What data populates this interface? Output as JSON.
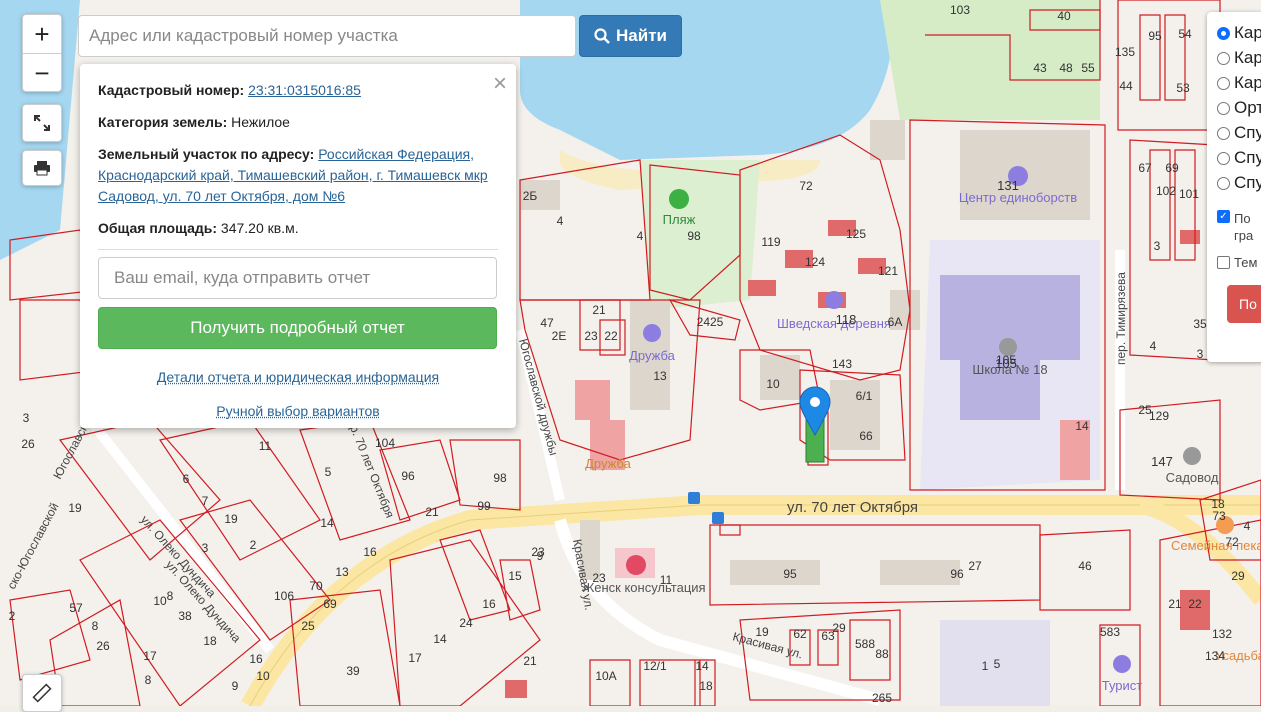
{
  "search": {
    "placeholder": "Адрес или кадастровый номер участка",
    "button_label": "Найти"
  },
  "controls": {
    "zoom_in": "+",
    "zoom_out": "−"
  },
  "popup": {
    "cad_label": "Кадастровый номер:",
    "cad_value": "23:31:0315016:85",
    "cat_label": "Категория земель:",
    "cat_value": "Нежилое",
    "addr_label": "Земельный участок по адресу:",
    "addr_value": "Российская Федерация, Краснодарский край, Тимашевский район, г. Тимашевск мкр Садовод, ул. 70 лет Октября, дом №6",
    "area_label": "Общая площадь:",
    "area_value": "347.20 кв.м.",
    "email_placeholder": "Ваш email, куда отправить отчет",
    "report_button": "Получить подробный отчет",
    "details_link": "Детали отчета и юридическая информация",
    "manual_link": "Ручной выбор вариантов",
    "close": "×"
  },
  "layers": {
    "radios": [
      "Кар",
      "Кар",
      "Кар",
      "Орт",
      "Спу",
      "Спу",
      "Спу"
    ],
    "selected_index": 0,
    "checkboxes": [
      {
        "label": "По",
        "label2": "гра",
        "checked": true
      },
      {
        "label": "Тем",
        "checked": false
      }
    ],
    "button": "По"
  },
  "map_labels": {
    "street_main": "ул. 70 лет Октября",
    "street_kras": "Красивая ул.",
    "street_kras2": "Красивая ул.",
    "street_yugo": "Югославской дружбы",
    "street_yugo2": "Югославской друж",
    "street_yugo3": "ско-Югославской",
    "street_oleko": "ул. Олеко Дундича",
    "street_oleko2": "ул. Олеко Дундича",
    "street_timir": "пер. Тимирязева",
    "street_70": "пер. 70 лет Октября",
    "poi_plyazh": "Пляж",
    "poi_druzhba": "Дружба",
    "poi_druzhba2": "Дружба",
    "poi_shved": "Шведская деревня",
    "poi_center": "Центр единоборств",
    "poi_school": "Школа № 18",
    "poi_sadovod": "Садовод",
    "poi_zhensk": "Женск консультация",
    "poi_semein": "Семейная пекарня",
    "poi_turist": "Турист",
    "poi_usadba": "Усадьба",
    "poi_131": "131",
    "poi_105": "105",
    "poi_118": "118",
    "poi_147": "147"
  },
  "parcel_numbers": [
    "103",
    "40",
    "135",
    "95",
    "54",
    "43",
    "48",
    "55",
    "44",
    "53",
    "72",
    "2Б",
    "4",
    "98",
    "4",
    "125",
    "119",
    "124",
    "121",
    "6А",
    "67",
    "69",
    "102",
    "101",
    "3",
    "47",
    "21",
    "2Е",
    "23",
    "22",
    "2425",
    "13",
    "143",
    "10",
    "6/1",
    "66",
    "105",
    "4",
    "35",
    "3",
    "25",
    "14",
    "129",
    "26",
    "104",
    "96",
    "98",
    "99",
    "21",
    "19",
    "6",
    "7",
    "19",
    "8",
    "2",
    "3",
    "11",
    "5",
    "14",
    "13",
    "16",
    "70",
    "69",
    "25",
    "106",
    "38",
    "57",
    "8",
    "26",
    "10",
    "17",
    "18",
    "16",
    "10",
    "9",
    "8",
    "23",
    "23",
    "11",
    "15",
    "16",
    "24",
    "14",
    "17",
    "21",
    "39",
    "95",
    "96",
    "27",
    "46",
    "583",
    "21",
    "22",
    "132",
    "134",
    "29",
    "62",
    "63",
    "29",
    "588",
    "88",
    "19",
    "5",
    "1",
    "265",
    "12/1",
    "14",
    "10А",
    "18",
    "73",
    "72",
    "4",
    "18",
    "3",
    "9",
    "2"
  ],
  "colors": {
    "parcel": "#d01c22",
    "water": "#a5d7f0",
    "green": "#cfe8c0",
    "road": "#fbe9a8",
    "building": "#ddd6cc",
    "school": "#b7b2e0",
    "marker": "#1e88e5"
  }
}
